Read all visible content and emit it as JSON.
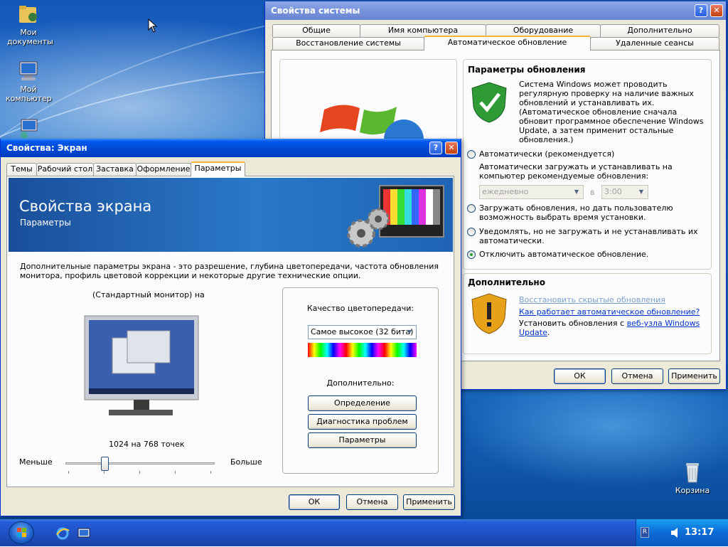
{
  "desktop": {
    "icons": [
      {
        "label": "Мои документы"
      },
      {
        "label": "Мой компьютер"
      },
      {
        "label": "Корзина"
      }
    ]
  },
  "sysprops": {
    "title": "Свойства системы",
    "tabs_row1": [
      "Общие",
      "Имя компьютера",
      "Оборудование",
      "Дополнительно"
    ],
    "tabs_row2": [
      "Восстановление системы",
      "Автоматическое обновление",
      "Удаленные сеансы"
    ],
    "update_heading": "Параметры обновления",
    "update_desc": "Система Windows может проводить регулярную проверку на наличие важных обновлений и устанавливать их. (Автоматическое обновление сначала обновит программное обеспечение Windows Update, а затем применит остальные обновления.)",
    "radio_auto": "Автоматически (рекомендуется)",
    "radio_auto_desc": "Автоматически загружать и устанавливать на компьютер рекомендуемые обновления:",
    "day_value": "ежедневно",
    "at_label": "в",
    "time_value": "3:00",
    "radio_download": "Загружать обновления, но дать пользователю возможность выбрать время установки.",
    "radio_notify": "Уведомлять, но не загружать и не устанавливать их автоматически.",
    "radio_off": "Отключить автоматическое обновление.",
    "extra_heading": "Дополнительно",
    "link_restore": "Восстановить скрытые обновления",
    "link_how": "Как работает автоматическое обновление?",
    "install_text": "Установить обновления с",
    "link_site": "веб-узла Windows Update",
    "install_end": ".",
    "ok": "ОК",
    "cancel": "Отмена",
    "apply": "Применить"
  },
  "display": {
    "title": "Свойства: Экран",
    "tabs": [
      "Темы",
      "Рабочий стол",
      "Заставка",
      "Оформление",
      "Параметры"
    ],
    "banner_title": "Свойства экрана",
    "banner_sub": "Параметры",
    "desc": "Дополнительные параметры экрана - это разрешение, глубина цветопередачи, частота обновления монитора, профиль цветовой коррекции и некоторые другие технические опции.",
    "monitor_label": "(Стандартный монитор) на",
    "resolution_text": "1024 на 768 точек",
    "slider_less": "Меньше",
    "slider_more": "Больше",
    "slider_position": 0.25,
    "color_quality_label": "Качество цветопередачи:",
    "color_quality_value": "Самое высокое (32 бита)",
    "advanced_label": "Дополнительно:",
    "btn_identify": "Определение",
    "btn_troubleshoot": "Диагностика проблем",
    "btn_params": "Параметры",
    "ok": "ОК",
    "cancel": "Отмена",
    "apply": "Применить"
  },
  "taskbar": {
    "lang": "R",
    "clock": "13:17"
  }
}
